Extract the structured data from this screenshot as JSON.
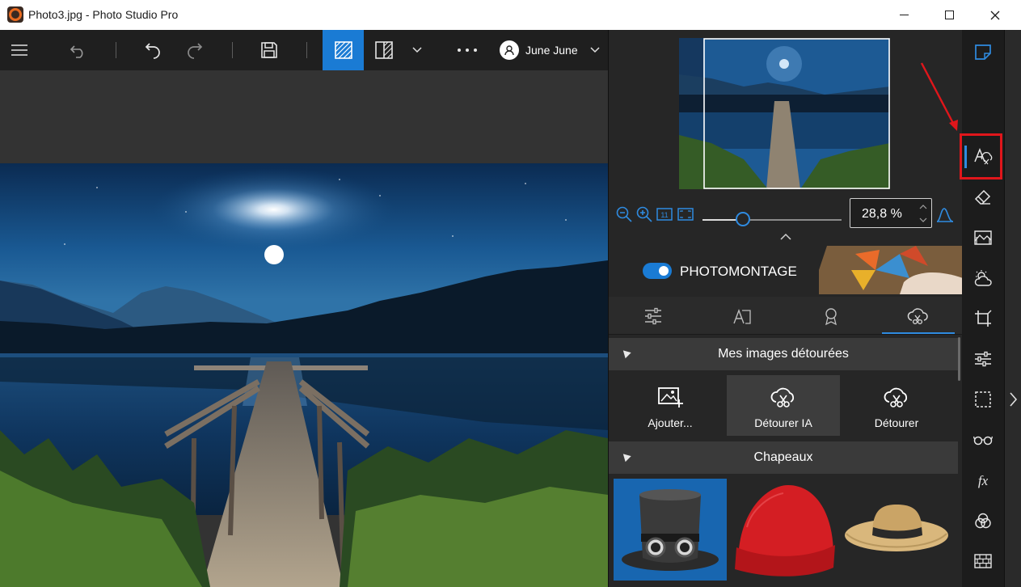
{
  "window": {
    "title": "Photo3.jpg - Photo Studio Pro"
  },
  "toolbar": {
    "user_name": "June June"
  },
  "zoom": {
    "value_text": "28,8 %",
    "slider_fraction": 0.29
  },
  "banner": {
    "label": "PHOTOMONTAGE",
    "toggle_on": true
  },
  "sections": {
    "cutouts": {
      "title": "Mes images détourées",
      "actions": [
        {
          "label": "Ajouter...",
          "icon": "add-image-icon"
        },
        {
          "label": "Détourer IA",
          "icon": "ai-cutout-icon"
        },
        {
          "label": "Détourer",
          "icon": "cutout-icon"
        }
      ]
    },
    "hats": {
      "title": "Chapeaux",
      "items": [
        "top-hat-with-goggles",
        "red-beanie",
        "straw-hat"
      ]
    }
  },
  "colors": {
    "accent": "#1a7bd4",
    "highlight": "#e0161b",
    "panel_bg": "#262626"
  }
}
